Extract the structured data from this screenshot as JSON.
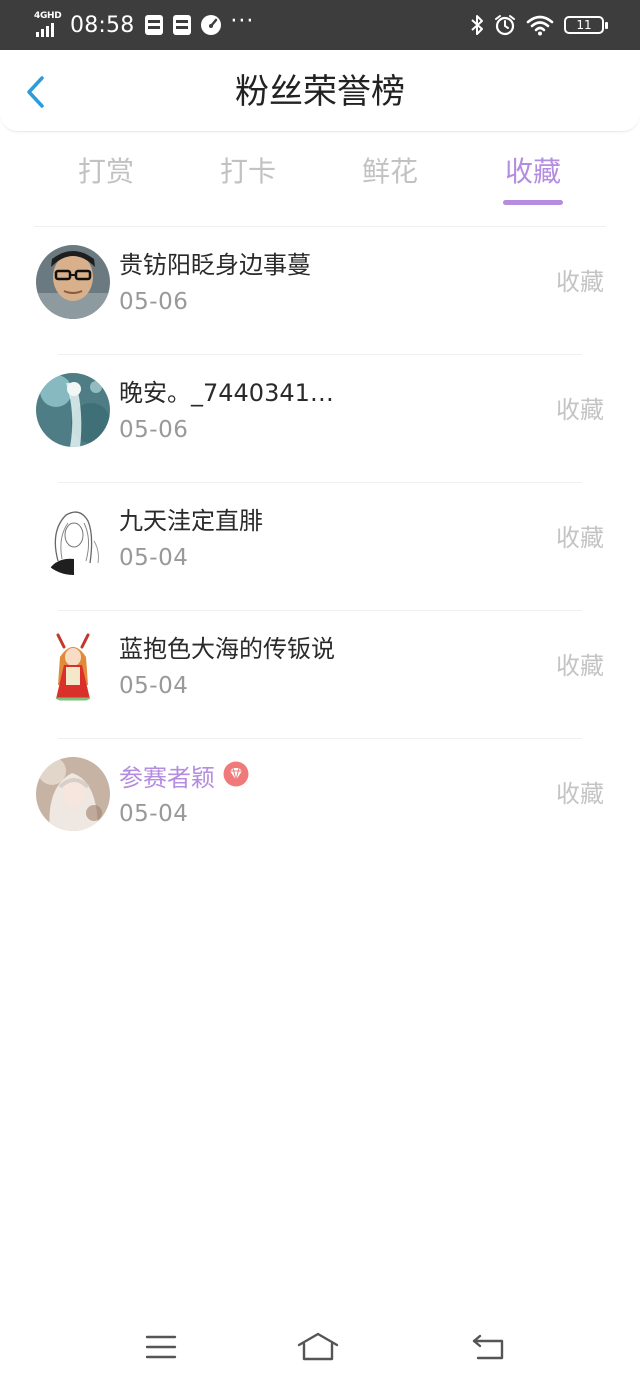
{
  "status_bar": {
    "network": "4GHD",
    "time": "08:58",
    "more": "···",
    "battery": "11",
    "icons": [
      "sim-card-icon",
      "sim-card-icon",
      "speedometer-icon",
      "bluetooth-icon",
      "alarm-icon",
      "wifi-icon",
      "battery-icon"
    ]
  },
  "header": {
    "title": "粉丝荣誉榜",
    "back_icon": "chevron-left-icon"
  },
  "tabs": [
    {
      "label": "打赏",
      "active": false
    },
    {
      "label": "打卡",
      "active": false
    },
    {
      "label": "鲜花",
      "active": false
    },
    {
      "label": "收藏",
      "active": true
    }
  ],
  "fans": [
    {
      "name": "贵钫阳眨身边事蔓",
      "date": "05-06",
      "action": "收藏",
      "vip": false
    },
    {
      "name": "晚安。_7440341…",
      "date": "05-06",
      "action": "收藏",
      "vip": false
    },
    {
      "name": "九天洼定直腓",
      "date": "05-04",
      "action": "收藏",
      "vip": false
    },
    {
      "name": "蓝抱色大海的传钣说",
      "date": "05-04",
      "action": "收藏",
      "vip": false
    },
    {
      "name": "参赛者颖",
      "date": "05-04",
      "action": "收藏",
      "vip": true,
      "badge_icon": "diamond-badge-icon"
    }
  ],
  "colors": {
    "accent": "#b48ce0",
    "status_bar_bg": "#3d3d3d",
    "back_arrow": "#2d9cdb",
    "badge": "#f07a7a"
  },
  "nav_bar": {
    "icons": [
      "menu-icon",
      "home-icon",
      "back-icon"
    ]
  }
}
